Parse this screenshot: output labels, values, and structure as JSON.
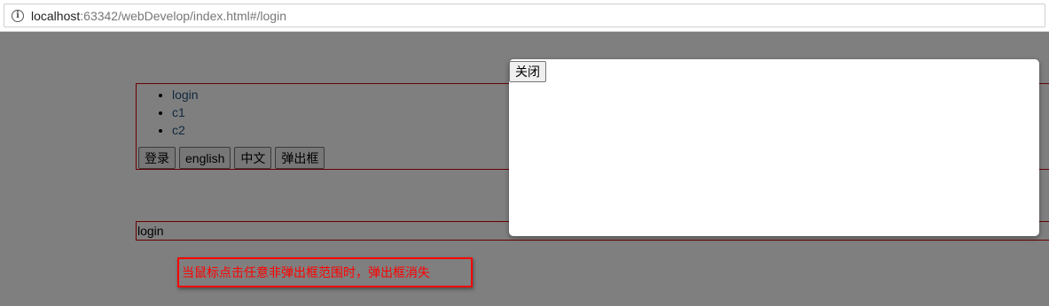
{
  "browser": {
    "url_host": "localhost",
    "url_rest": ":63342/webDevelop/index.html#/login"
  },
  "nav": {
    "items": [
      {
        "label": "login"
      },
      {
        "label": "c1"
      },
      {
        "label": "c2"
      }
    ],
    "buttons": {
      "login": "登录",
      "english": "english",
      "chinese": "中文",
      "popup": "弹出框"
    }
  },
  "view": {
    "text": "login"
  },
  "modal": {
    "close_label": "关闭"
  },
  "annotation": {
    "text": "当鼠标点击任意非弹出框范围时，弹出框消失"
  },
  "colors": {
    "border_accent": "#d00000",
    "link": "#23527c",
    "overlay": "rgba(0,0,0,0.5)",
    "annotation": "#ff0000"
  }
}
